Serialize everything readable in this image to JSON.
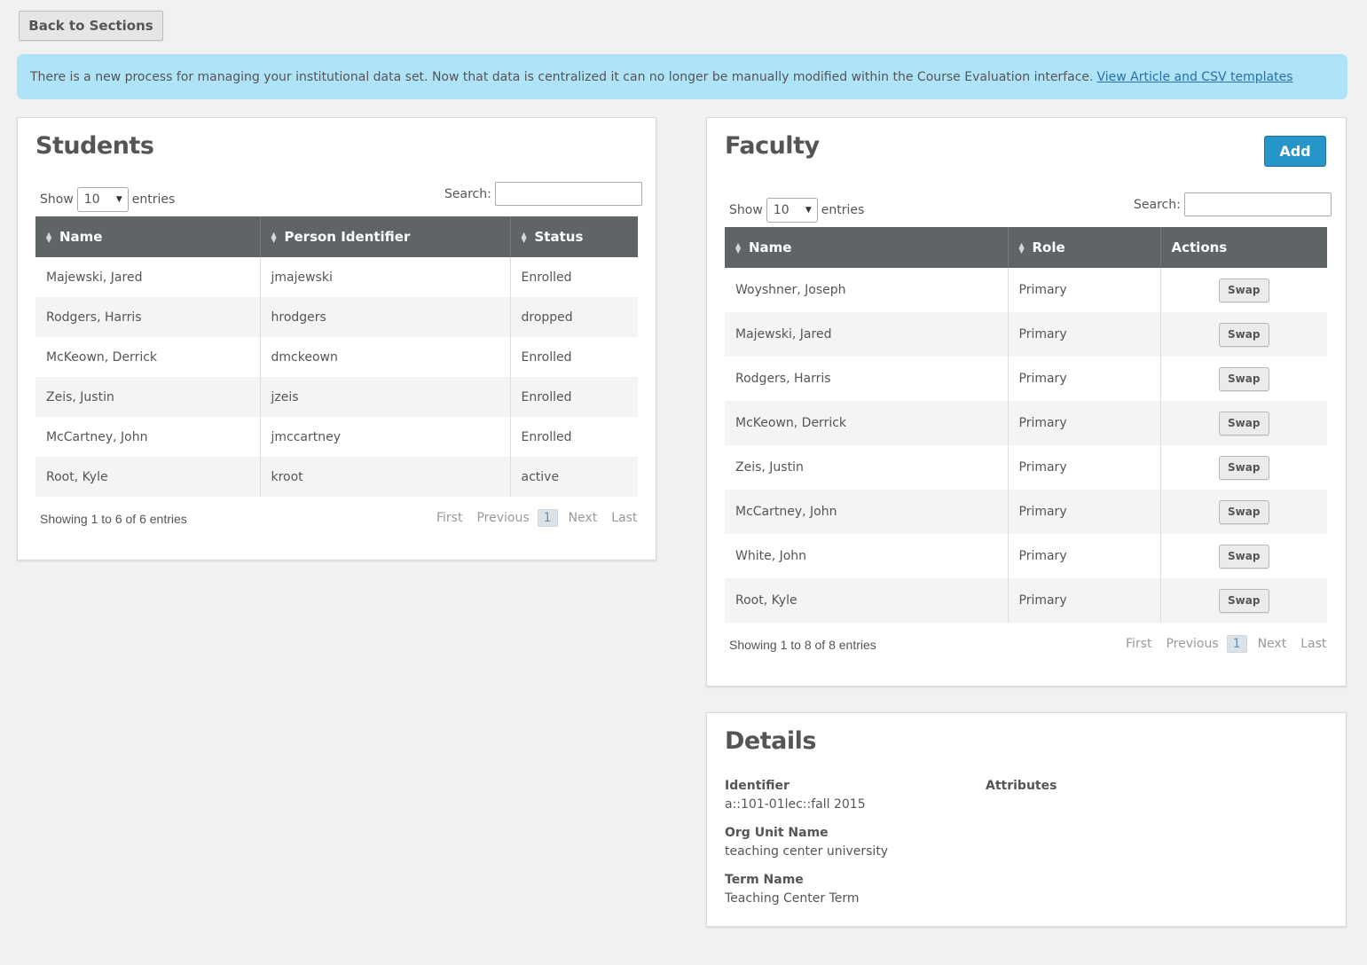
{
  "back_button": "Back to Sections",
  "notice": {
    "text": "There is a new process for managing your institutional data set. Now that data is centralized it can no longer be manually modified within the Course Evaluation interface.",
    "link": "View Article and CSV templates"
  },
  "students": {
    "title": "Students",
    "show_label": "Show",
    "entries_value": "10",
    "entries_label": "entries",
    "search_label": "Search:",
    "columns": [
      "Name",
      "Person Identifier",
      "Status"
    ],
    "rows": [
      [
        "Majewski, Jared",
        "jmajewski",
        "Enrolled"
      ],
      [
        "Rodgers, Harris",
        "hrodgers",
        "dropped"
      ],
      [
        "McKeown, Derrick",
        "dmckeown",
        "Enrolled"
      ],
      [
        "Zeis, Justin",
        "jzeis",
        "Enrolled"
      ],
      [
        "McCartney, John",
        "jmccartney",
        "Enrolled"
      ],
      [
        "Root, Kyle",
        "kroot",
        "active"
      ]
    ],
    "info": "Showing 1 to 6 of 6 entries",
    "pager": {
      "first": "First",
      "previous": "Previous",
      "current": "1",
      "next": "Next",
      "last": "Last"
    }
  },
  "faculty": {
    "title": "Faculty",
    "add_button": "Add",
    "show_label": "Show",
    "entries_value": "10",
    "entries_label": "entries",
    "search_label": "Search:",
    "columns": [
      "Name",
      "Role",
      "Actions"
    ],
    "swap_label": "Swap",
    "rows": [
      [
        "Woyshner, Joseph",
        "Primary"
      ],
      [
        "Majewski, Jared",
        "Primary"
      ],
      [
        "Rodgers, Harris",
        "Primary"
      ],
      [
        "McKeown, Derrick",
        "Primary"
      ],
      [
        "Zeis, Justin",
        "Primary"
      ],
      [
        "McCartney, John",
        "Primary"
      ],
      [
        "White, John",
        "Primary"
      ],
      [
        "Root, Kyle",
        "Primary"
      ]
    ],
    "info": "Showing 1 to 8 of 8 entries",
    "pager": {
      "first": "First",
      "previous": "Previous",
      "current": "1",
      "next": "Next",
      "last": "Last"
    }
  },
  "details": {
    "title": "Details",
    "identifier_label": "Identifier",
    "identifier_value": "a::101-01lec::fall 2015",
    "org_unit_label": "Org Unit Name",
    "org_unit_value": "teaching center university",
    "term_label": "Term Name",
    "term_value": "Teaching Center Term",
    "attributes_label": "Attributes"
  },
  "colors": {
    "notice_bg": "#aee3f8",
    "table_header": "#5f6467",
    "add_button": "#2695c9",
    "link": "#2a6fa8"
  }
}
